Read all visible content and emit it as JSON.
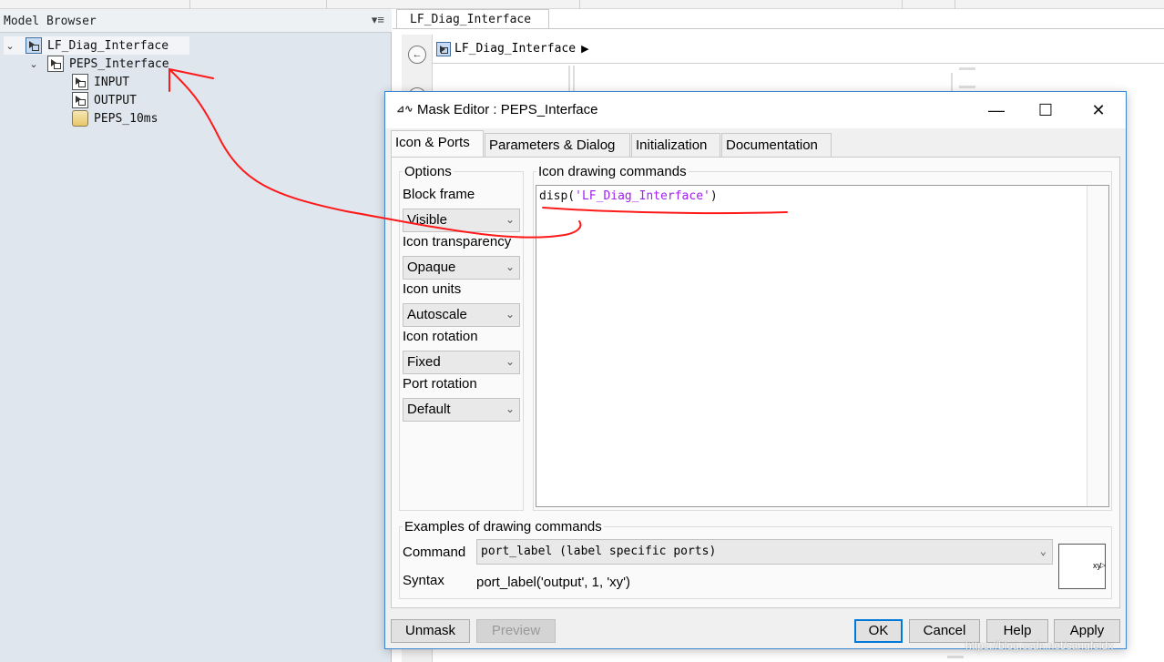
{
  "browser": {
    "title": "Model Browser",
    "menu_icon": "list-menu-icon",
    "tree": [
      {
        "label": "LF_Diag_Interface",
        "icon": "block-diagram-icon"
      },
      {
        "label": "PEPS_Interface",
        "icon": "subsystem-icon"
      },
      {
        "label": "INPUT",
        "icon": "subsystem-icon"
      },
      {
        "label": "OUTPUT",
        "icon": "subsystem-icon"
      },
      {
        "label": "PEPS_10ms",
        "icon": "stateflow-chart-icon"
      }
    ]
  },
  "editor": {
    "tab_label": "LF_Diag_Interface",
    "breadcrumb": "LF_Diag_Interface"
  },
  "dialog": {
    "title": "Mask Editor : PEPS_Interface",
    "tabs": [
      "Icon & Ports",
      "Parameters & Dialog",
      "Initialization",
      "Documentation"
    ],
    "options_label": "Options",
    "options": [
      {
        "label": "Block frame",
        "value": "Visible"
      },
      {
        "label": "Icon transparency",
        "value": "Opaque"
      },
      {
        "label": "Icon units",
        "value": "Autoscale"
      },
      {
        "label": "Icon rotation",
        "value": "Fixed"
      },
      {
        "label": "Port rotation",
        "value": "Default"
      }
    ],
    "drawing_label": "Icon drawing commands",
    "code": {
      "fn": "disp(",
      "str": "'LF_Diag_Interface'",
      "close": ")"
    },
    "examples_label": "Examples of drawing commands",
    "command_label": "Command",
    "command_value": "port_label (label specific ports)",
    "syntax_label": "Syntax",
    "syntax_value": "port_label('output', 1, 'xy')",
    "preview_text": "xy",
    "buttons": {
      "unmask": "Unmask",
      "preview": "Preview",
      "ok": "OK",
      "cancel": "Cancel",
      "help": "Help",
      "apply": "Apply"
    }
  },
  "watermark": "https://blog.csdn.net/sangfeidx",
  "colors": {
    "annotation_red": "#ff1a1a",
    "dialog_border": "#3a86d0",
    "string_purple": "#a020f0"
  }
}
